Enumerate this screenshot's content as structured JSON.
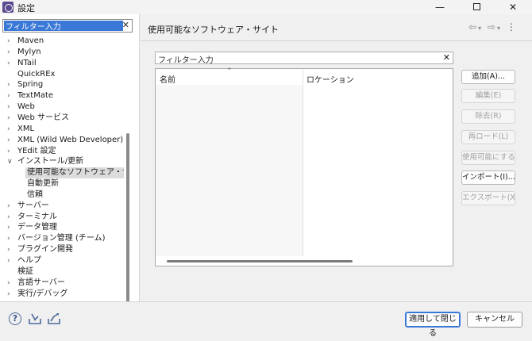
{
  "window": {
    "title": "設定"
  },
  "filter": {
    "value": "フィルター入力"
  },
  "tree": [
    {
      "label": "Maven",
      "arrow": true,
      "indent": 0
    },
    {
      "label": "Mylyn",
      "arrow": true,
      "indent": 0
    },
    {
      "label": "NTail",
      "arrow": true,
      "indent": 0
    },
    {
      "label": "QuickREx",
      "arrow": false,
      "indent": 0
    },
    {
      "label": "Spring",
      "arrow": true,
      "indent": 0
    },
    {
      "label": "TextMate",
      "arrow": true,
      "indent": 0
    },
    {
      "label": "Web",
      "arrow": true,
      "indent": 0
    },
    {
      "label": "Web サービス",
      "arrow": true,
      "indent": 0
    },
    {
      "label": "XML",
      "arrow": true,
      "indent": 0
    },
    {
      "label": "XML (Wild Web Developer)",
      "arrow": true,
      "indent": 0
    },
    {
      "label": "YEdit 設定",
      "arrow": true,
      "indent": 0
    },
    {
      "label": "インストール/更新",
      "arrow": "open",
      "indent": 0
    },
    {
      "label": "使用可能なソフトウェア・サイト",
      "arrow": false,
      "indent": 1,
      "selected": true
    },
    {
      "label": "自動更新",
      "arrow": false,
      "indent": 1
    },
    {
      "label": "信頼",
      "arrow": false,
      "indent": 1
    },
    {
      "label": "サーバー",
      "arrow": true,
      "indent": 0
    },
    {
      "label": "ターミナル",
      "arrow": true,
      "indent": 0
    },
    {
      "label": "データ管理",
      "arrow": true,
      "indent": 0
    },
    {
      "label": "バージョン管理 (チーム)",
      "arrow": true,
      "indent": 0
    },
    {
      "label": "プラグイン開発",
      "arrow": true,
      "indent": 0
    },
    {
      "label": "ヘルプ",
      "arrow": true,
      "indent": 0
    },
    {
      "label": "検証",
      "arrow": false,
      "indent": 0
    },
    {
      "label": "言語サーバー",
      "arrow": true,
      "indent": 0
    },
    {
      "label": "実行/デバッグ",
      "arrow": true,
      "indent": 0
    }
  ],
  "page": {
    "title": "使用可能なソフトウェア・サイト",
    "site_filter": "フィルター入力",
    "columns": [
      "名前",
      "ロケーション"
    ]
  },
  "buttons": {
    "add": "追加(A)...",
    "edit": "編集(E)",
    "remove": "除去(R)",
    "reload": "再ロード(L)",
    "enable": "使用可能にする(N)",
    "import": "インポート(I)...",
    "export": "エクスポート(X)..."
  },
  "footer": {
    "apply_close": "適用して閉じる",
    "cancel": "キャンセル"
  }
}
